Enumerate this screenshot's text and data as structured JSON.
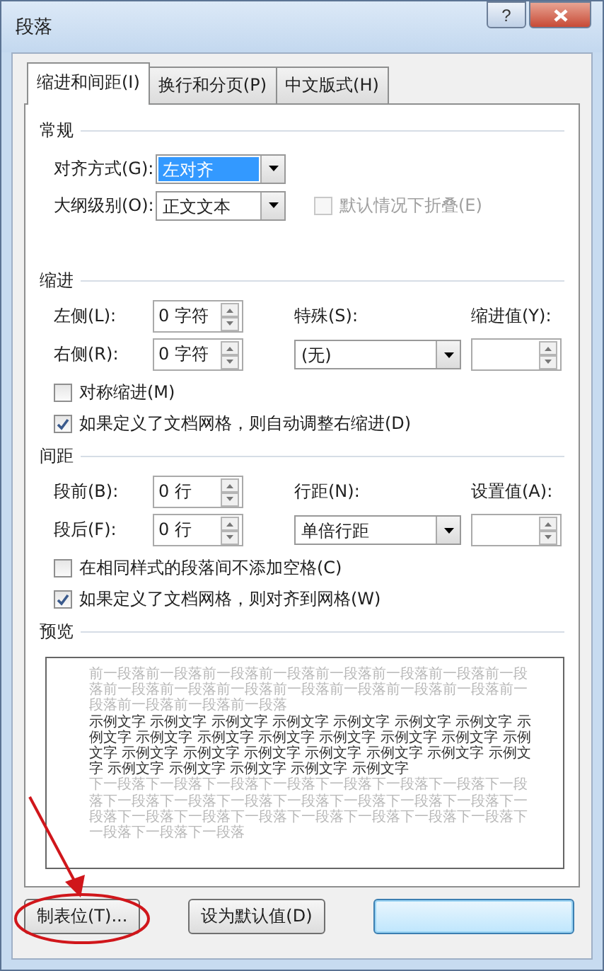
{
  "window": {
    "title": "段落",
    "help_button": "?"
  },
  "tabs": [
    {
      "label": "缩进和间距(I)",
      "selected": true
    },
    {
      "label": "换行和分页(P)",
      "selected": false
    },
    {
      "label": "中文版式(H)",
      "selected": false
    }
  ],
  "general": {
    "heading": "常规",
    "alignment": {
      "label": "对齐方式(G):",
      "value": "左对齐",
      "highlighted": true
    },
    "outline_level": {
      "label": "大纲级别(O):",
      "value": "正文文本",
      "highlighted": false
    },
    "collapse": {
      "label": "默认情况下折叠(E)",
      "checked": false,
      "disabled": true
    }
  },
  "indent": {
    "heading": "缩进",
    "left": {
      "label": "左侧(L):",
      "value": "0 字符"
    },
    "right": {
      "label": "右侧(R):",
      "value": "0 字符"
    },
    "special": {
      "label": "特殊(S):",
      "value": "(无)"
    },
    "by": {
      "label": "缩进值(Y):"
    },
    "checkboxes": [
      {
        "label": "对称缩进(M)",
        "checked": false,
        "disabled": false
      },
      {
        "label": "如果定义了文档网格，则自动调整右缩进(D)",
        "checked": true,
        "disabled": false
      }
    ]
  },
  "spacing": {
    "heading": "间距",
    "before": {
      "label": "段前(B):",
      "value": "0 行"
    },
    "after": {
      "label": "段后(F):",
      "value": "0 行"
    },
    "line_spacing": {
      "label": "行距(N):",
      "value": "单倍行距"
    },
    "at": {
      "label": "设置值(A):"
    },
    "checkboxes": [
      {
        "label": "在相同样式的段落间不添加空格(C)",
        "checked": false,
        "disabled": false
      },
      {
        "label": "如果定义了文档网格，则对齐到网格(W)",
        "checked": true,
        "disabled": false
      }
    ]
  },
  "preview": {
    "heading": "预览",
    "previous_text": "前一段落前一段落前一段落前一段落前一段落前一段落前一段落前一段落前一段落前一段落前一段落前一段落前一段落前一段落前一段落前一段落前一段落前一段落前一段落",
    "sample_text": "示例文字 示例文字 示例文字 示例文字 示例文字 示例文字 示例文字 示例文字 示例文字 示例文字 示例文字 示例文字 示例文字 示例文字 示例文字 示例文字 示例文字 示例文字 示例文字 示例文字 示例文字 示例文字 示例文字 示例文字 示例文字 示例文字 示例文字",
    "next_text": "下一段落下一段落下一段落下一段落下一段落下一段落下一段落下一段落下一段落下一段落下一段落下一段落下一段落下一段落下一段落下一段落下一段落下一段落下一段落下一段落下一段落下一段落下一段落下一段落下一段落下一段落"
  },
  "buttons": [
    {
      "label": "制表位(T)...",
      "default": false
    },
    {
      "label": "设为默认值(D)",
      "default": false
    },
    {
      "default": true
    }
  ]
}
